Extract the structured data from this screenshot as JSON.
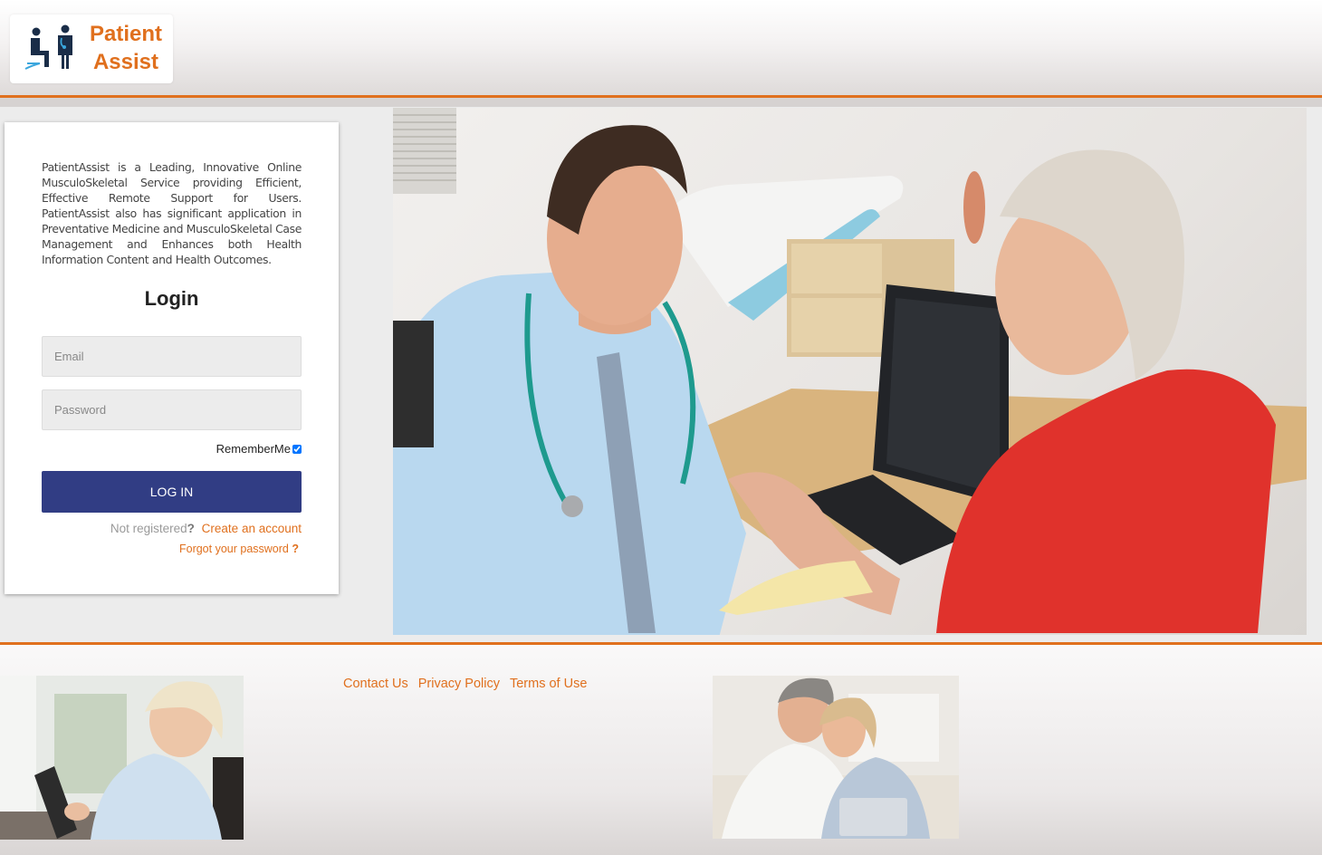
{
  "header": {
    "logo_line1": "Patient",
    "logo_line2": "Assist",
    "accent_color": "#e0701e"
  },
  "login": {
    "intro": "PatientAssist is a Leading, Innovative Online MusculoSkeletal Service providing Efficient, Effective Remote Support for Users. PatientAssist also has significant application in Preventative Medicine and MusculoSkeletal Case Management and Enhances both Health Information Content and Health Outcomes.",
    "title": "Login",
    "email_placeholder": "Email",
    "password_placeholder": "Password",
    "remember_label": "RememberMe",
    "remember_checked": true,
    "login_button": "LOG IN",
    "not_registered": "Not registered",
    "not_registered_q": "?",
    "create_account": "Create an account",
    "forgot_password": "Forgot your password",
    "forgot_q": "?",
    "button_color": "#313d84"
  },
  "footer": {
    "links": [
      "Contact Us",
      "Privacy Policy",
      "Terms of Use"
    ]
  },
  "images": {
    "hero": "doctor-consulting-patient-photo",
    "footer_left": "woman-with-tablet-photo",
    "footer_right": "couple-with-tablet-photo"
  }
}
